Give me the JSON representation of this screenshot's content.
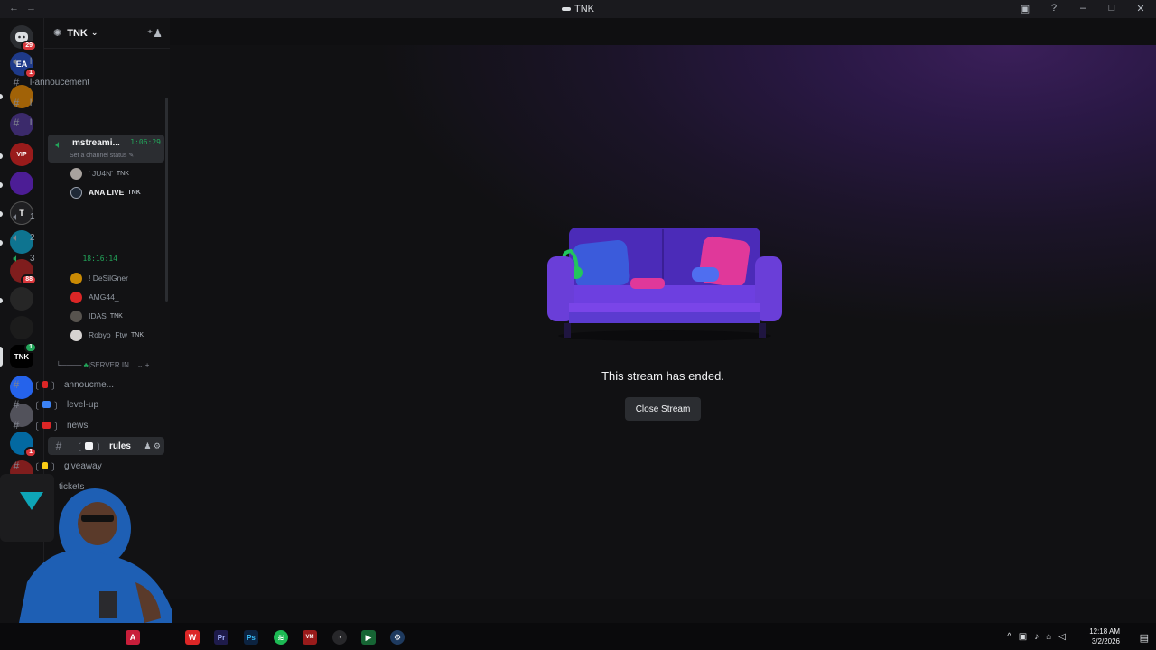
{
  "window": {
    "title": "TNK",
    "inbox_icon": "inbox-icon",
    "help_icon": "help-icon"
  },
  "guild": {
    "name": "TNK"
  },
  "channels_top": [
    {
      "icon": "speaker",
      "label": "l"
    },
    {
      "icon": "hash",
      "label": "l-annoucement"
    },
    {
      "icon": "hash",
      "label": "l"
    },
    {
      "icon": "hash",
      "label": "l"
    }
  ],
  "voice_active": {
    "label": "mstreami...",
    "time": "1:06:29",
    "status": "Set a channel status"
  },
  "voice_users_1": [
    {
      "name": "' JU4N'",
      "tag": "TNK"
    },
    {
      "name": "ANA LIVE",
      "tag": "TNK"
    }
  ],
  "voice_channels": [
    {
      "label": "1"
    },
    {
      "label": "2"
    },
    {
      "label": "3",
      "time": "18:16:14"
    }
  ],
  "voice_users_3": [
    {
      "name": "! DeSilGner"
    },
    {
      "name": "AMG44_"
    },
    {
      "name": "IDAS",
      "tag": "TNK"
    },
    {
      "name": "Robyo_Ftw",
      "tag": "TNK"
    }
  ],
  "category": {
    "label": "|SERVER IN..."
  },
  "channels_bottom": [
    {
      "label": "annoucme..."
    },
    {
      "label": "level-up"
    },
    {
      "label": "news"
    },
    {
      "label": "rules"
    },
    {
      "label": "giveaway"
    },
    {
      "label": "tickets"
    }
  ],
  "server_badges": {
    "dm": "29",
    "ea": "1",
    "s9": "88",
    "tnk": "1",
    "s14": "1"
  },
  "stream": {
    "message": "This stream has ended.",
    "close_label": "Close Stream"
  },
  "clock": {
    "time": "12:18 AM",
    "date": "3/2/2026"
  },
  "colors": {
    "accent_green": "#23a55a",
    "badge_red": "#da373c",
    "bg_dark": "#121214",
    "button_bg": "#2b2d31"
  }
}
